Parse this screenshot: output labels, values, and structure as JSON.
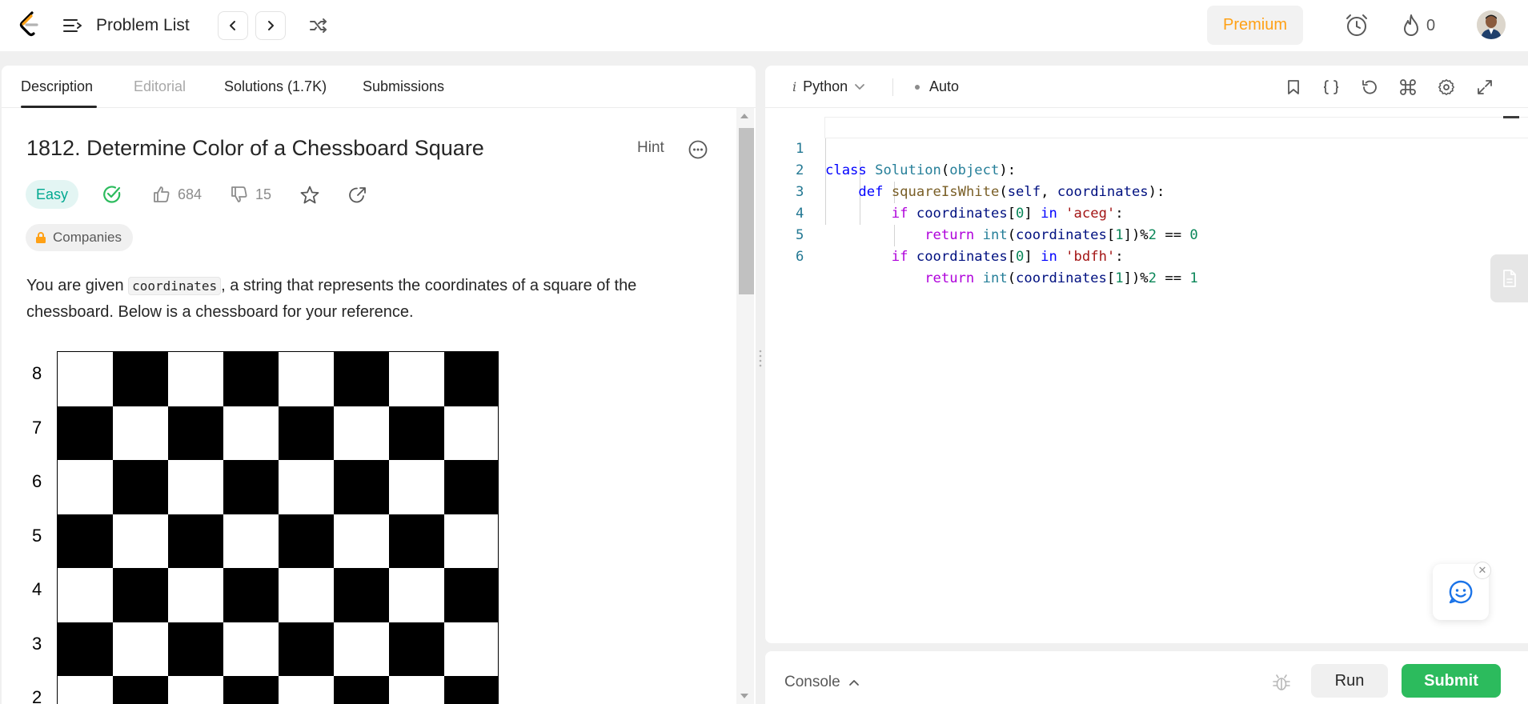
{
  "nav": {
    "problem_list": "Problem List",
    "premium": "Premium",
    "streak_count": "0"
  },
  "tabs": [
    {
      "label": "Description"
    },
    {
      "label": "Editorial"
    },
    {
      "label": "Solutions (1.7K)"
    },
    {
      "label": "Submissions"
    }
  ],
  "problem": {
    "title": "1812. Determine Color of a Chessboard Square",
    "hint": "Hint",
    "difficulty": "Easy",
    "likes": "684",
    "dislikes": "15",
    "companies": "Companies",
    "desc_before": "You are given ",
    "desc_code": "coordinates",
    "desc_after": ", a string that represents the coordinates of a square of the chessboard. Below is a chessboard for your reference."
  },
  "board": {
    "ranks": [
      "8",
      "7",
      "6",
      "5",
      "4",
      "3",
      "2"
    ]
  },
  "editor": {
    "language": "Python",
    "language_prefix": "i",
    "mode": "Auto",
    "line_numbers": [
      "1",
      "2",
      "3",
      "4",
      "5",
      "6"
    ]
  },
  "console": {
    "label": "Console",
    "run": "Run",
    "submit": "Submit"
  },
  "colors": {
    "accent_orange": "#ffa116",
    "easy_teal": "#00a890",
    "submit_green": "#2cbb5d",
    "chat_blue": "#1a73e8"
  }
}
